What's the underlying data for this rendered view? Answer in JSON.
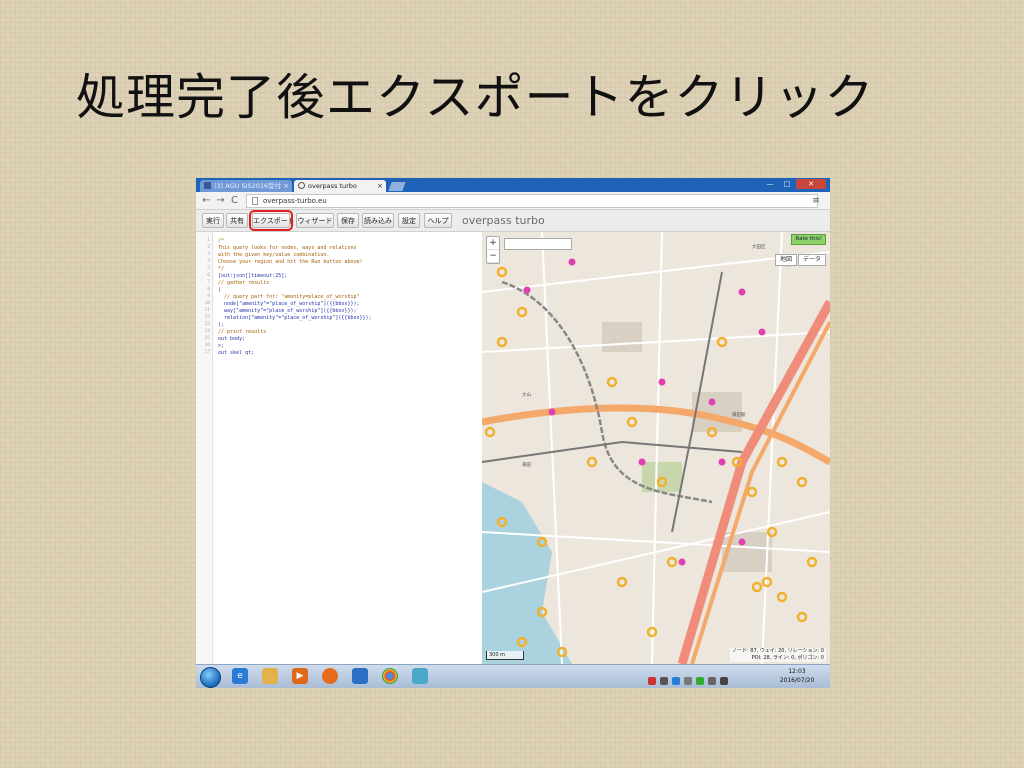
{
  "slide": {
    "title": "処理完了後エクスポートをクリック"
  },
  "browser": {
    "tabs": [
      {
        "label": "(3) AGU SIS2016受付",
        "active": false
      },
      {
        "label": "overpass turbo",
        "active": true
      }
    ],
    "tab_close": "×",
    "window_buttons": {
      "minimize": "—",
      "maximize": "□",
      "close": "✕"
    },
    "nav": {
      "back": "←",
      "forward": "→",
      "reload": "C"
    },
    "url": "overpass-turbo.eu",
    "menu_icon": "≡"
  },
  "toolbar": {
    "run": "実行",
    "share": "共有",
    "export": "エクスポート",
    "wizard": "ウィザード",
    "save": "保存",
    "load": "読み込み",
    "settings": "設定",
    "help": "ヘルプ",
    "export_highlight_color": "#e02020"
  },
  "app": {
    "brand": "overpass turbo"
  },
  "editor": {
    "line_numbers": [
      "1",
      "2",
      "3",
      "4",
      "5",
      "6",
      "7",
      "8",
      "9",
      "10",
      "11",
      "12",
      "13",
      "14",
      "15",
      "16",
      "17"
    ],
    "lines": [
      "/*",
      "This query looks for nodes, ways and relations",
      "with the given key/value combination.",
      "Choose your region and hit the Run button above!",
      "*/",
      "[out:json][timeout:25];",
      "// gather results",
      "(",
      "  // query part for: \"amenity=place_of_worship\"",
      "  node[\"amenity\"=\"place_of_worship\"]({{bbox}});",
      "  way[\"amenity\"=\"place_of_worship\"]({{bbox}});",
      "  relation[\"amenity\"=\"place_of_worship\"]({{bbox}});",
      ");",
      "// print results",
      "out body;",
      ">;",
      "out skel qt;"
    ]
  },
  "map": {
    "zoom_in": "+",
    "zoom_out": "−",
    "tab_map": "地図",
    "tab_data": "データ",
    "rate_button": "Rate this!",
    "scale": "300 m",
    "stats_line1": "ノード: 87, ウェイ: 20, リレーション: 0",
    "stats_line2": "POI: 28, ライン: 0, ポリゴン: 0",
    "marker_color_worship": "#e040b0",
    "marker_color_poi": "#f0b030",
    "main_road_color": "#f4a96a"
  },
  "taskbar": {
    "time": "12:03",
    "date": "2016/07/20"
  }
}
